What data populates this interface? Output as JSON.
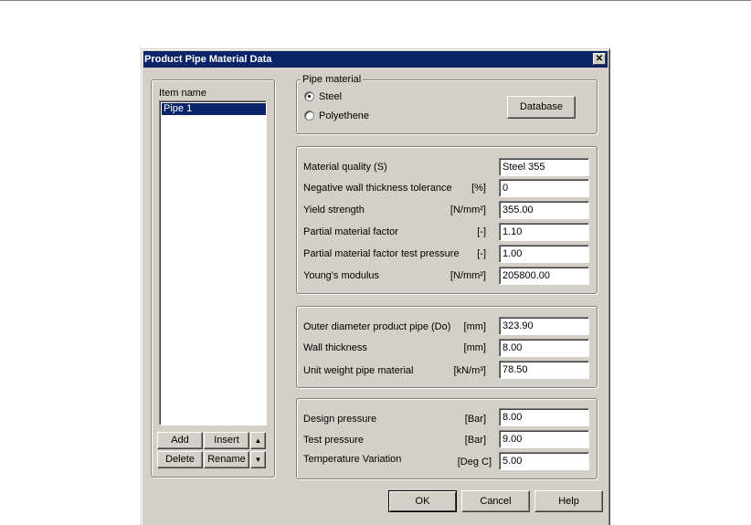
{
  "dialog": {
    "title": "Product Pipe Material Data",
    "close_glyph": "✕"
  },
  "items": {
    "group_label": "Item name",
    "list": [
      "Pipe 1"
    ],
    "buttons": {
      "add": "Add",
      "insert": "Insert",
      "delete": "Delete",
      "rename": "Rename",
      "up_glyph": "▲",
      "down_glyph": "▼"
    }
  },
  "pipe_material": {
    "group_label": "Pipe material",
    "options": [
      "Steel",
      "Polyethene"
    ],
    "selected": "Steel",
    "database_button": "Database"
  },
  "material_props": [
    {
      "label": "Material quality (S)",
      "unit": "",
      "value": "Steel 355"
    },
    {
      "label": "Negative wall thickness tolerance",
      "unit": "[%]",
      "value": "0"
    },
    {
      "label": "Yield strength",
      "unit": "[N/mm²]",
      "value": "355.00"
    },
    {
      "label": "Partial material factor",
      "unit": "[-]",
      "value": "1.10"
    },
    {
      "label": "Partial material factor test pressure",
      "unit": "[-]",
      "value": "1.00"
    },
    {
      "label": "Young's modulus",
      "unit": "[N/mm²]",
      "value": "205800.00"
    }
  ],
  "geometry_props": [
    {
      "label": "Outer diameter product pipe (Do)",
      "unit": "[mm]",
      "value": "323.90"
    },
    {
      "label": "Wall thickness",
      "unit": "[mm]",
      "value": "8.00"
    },
    {
      "label": "Unit weight pipe material",
      "unit": "[kN/m³]",
      "value": "78.50"
    }
  ],
  "pressure_props": [
    {
      "label": "Design pressure",
      "unit": "[Bar]",
      "value": "8.00"
    },
    {
      "label": "Test pressure",
      "unit": "[Bar]",
      "value": "9.00"
    },
    {
      "label": "Temperature Variation",
      "unit": "[Deg C]",
      "value": "5.00"
    }
  ],
  "footer": {
    "ok": "OK",
    "cancel": "Cancel",
    "help": "Help"
  }
}
